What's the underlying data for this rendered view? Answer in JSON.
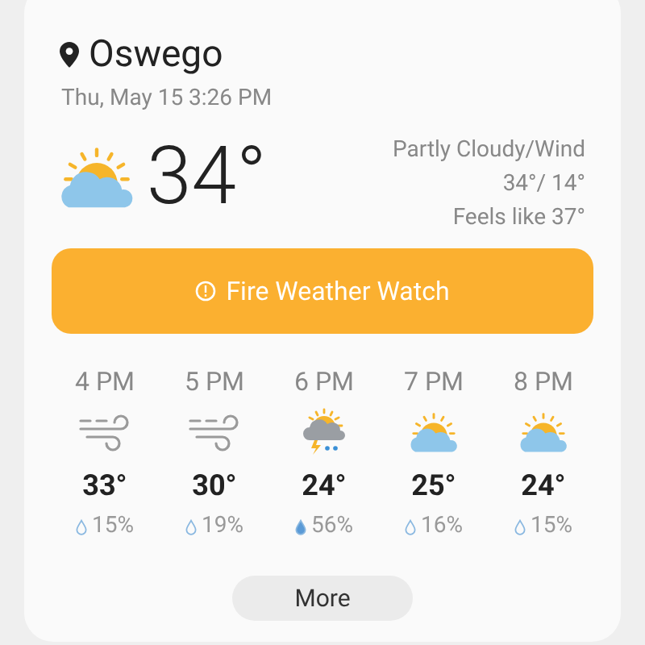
{
  "location": {
    "name": "Oswego",
    "datetime": "Thu, May 15 3:26 PM"
  },
  "current": {
    "kind": "partly-cloudy",
    "temperature": "34°",
    "condition": "Partly Cloudy/Wind",
    "high_low": "34°/ 14°",
    "feels_like": "Feels like 37°"
  },
  "alert": {
    "label": "Fire Weather Watch"
  },
  "hourly": [
    {
      "time": "4 PM",
      "kind": "wind",
      "temperature": "33°",
      "precip_filled": false,
      "precip": "15%"
    },
    {
      "time": "5 PM",
      "kind": "wind",
      "temperature": "30°",
      "precip_filled": false,
      "precip": "19%"
    },
    {
      "time": "6 PM",
      "kind": "storm",
      "temperature": "24°",
      "precip_filled": true,
      "precip": "56%"
    },
    {
      "time": "7 PM",
      "kind": "partly-cloudy",
      "temperature": "25°",
      "precip_filled": false,
      "precip": "16%"
    },
    {
      "time": "8 PM",
      "kind": "partly-cloudy",
      "temperature": "24°",
      "precip_filled": false,
      "precip": "15%"
    }
  ],
  "more_button": {
    "label": "More"
  }
}
